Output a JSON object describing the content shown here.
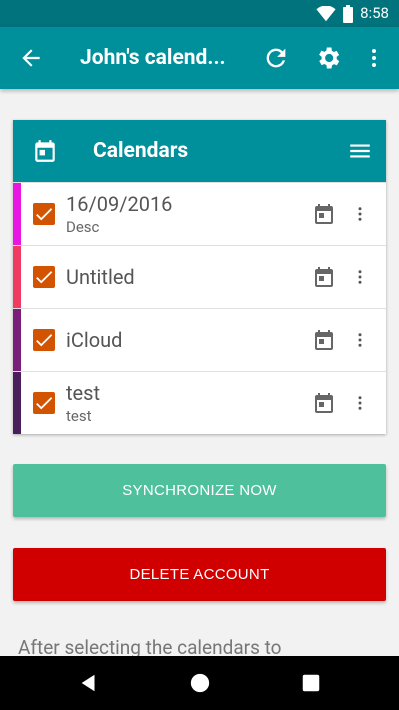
{
  "status_bar": {
    "time": "8:58"
  },
  "app_bar": {
    "title": "John's calend..."
  },
  "card": {
    "title": "Calendars"
  },
  "calendars": [
    {
      "name": "16/09/2016",
      "description": "Desc",
      "color": "#e815e3",
      "checked": true
    },
    {
      "name": "Untitled",
      "description": "",
      "color": "#f03a5f",
      "checked": true
    },
    {
      "name": "iCloud",
      "description": "",
      "color": "#7b1e7a",
      "checked": true
    },
    {
      "name": "test",
      "description": "test",
      "color": "#4a1e5b",
      "checked": true
    }
  ],
  "buttons": {
    "sync": "SYNCHRONIZE NOW",
    "delete": "DELETE ACCOUNT"
  },
  "info_text": "After selecting the calendars to",
  "colors": {
    "primary": "#00909b",
    "primary_dark": "#00737c",
    "sync": "#4fc09c",
    "delete": "#d10000",
    "checkbox": "#d35400"
  }
}
